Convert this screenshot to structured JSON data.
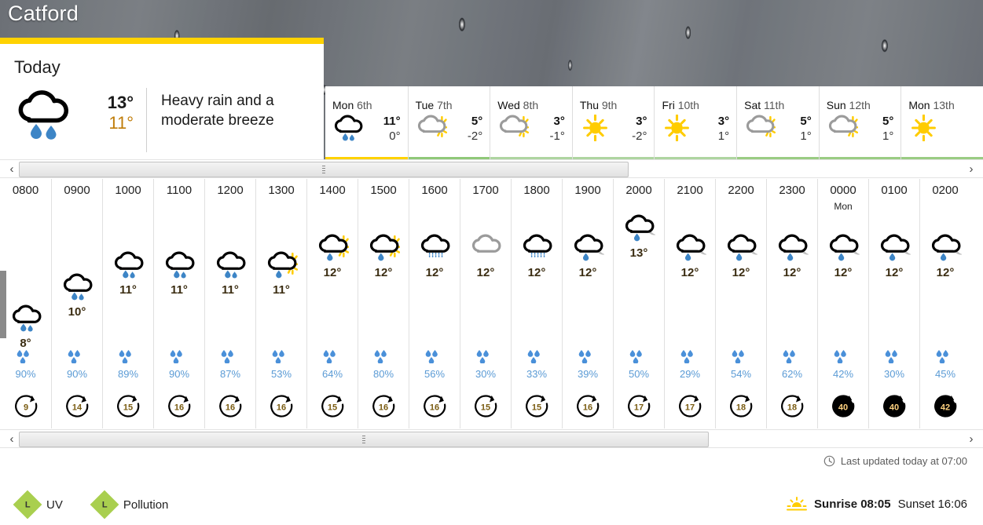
{
  "location": {
    "name": "Catford"
  },
  "today": {
    "label": "Today",
    "icon": "heavy-rain-icon",
    "high": "13°",
    "low": "11°",
    "description": "Heavy rain and a moderate breeze"
  },
  "day_tabs": [
    {
      "day": "Mon",
      "date": "6th",
      "icon": "light-rain-icon",
      "high": "11°",
      "low": "0°",
      "bar_color": "#ffd200",
      "active": true
    },
    {
      "day": "Tue",
      "date": "7th",
      "icon": "sunny-intervals-icon",
      "high": "5°",
      "low": "-2°",
      "bar_color": "#8fc878",
      "active": false
    },
    {
      "day": "Wed",
      "date": "8th",
      "icon": "sunny-intervals-icon",
      "high": "3°",
      "low": "-1°",
      "bar_color": "#aed5a0",
      "active": false
    },
    {
      "day": "Thu",
      "date": "9th",
      "icon": "sunny-icon",
      "high": "3°",
      "low": "-2°",
      "bar_color": "#aed5a0",
      "active": false
    },
    {
      "day": "Fri",
      "date": "10th",
      "icon": "sunny-icon",
      "high": "3°",
      "low": "1°",
      "bar_color": "#aed5a0",
      "active": false
    },
    {
      "day": "Sat",
      "date": "11th",
      "icon": "sunny-intervals-icon",
      "high": "5°",
      "low": "1°",
      "bar_color": "#9acc83",
      "active": false
    },
    {
      "day": "Sun",
      "date": "12th",
      "icon": "sunny-intervals-icon",
      "high": "5°",
      "low": "1°",
      "bar_color": "#9acc83",
      "active": false
    },
    {
      "day": "Mon",
      "date": "13th",
      "icon": "sunny-icon",
      "high": "",
      "low": "",
      "bar_color": "#9acc83",
      "active": false
    }
  ],
  "hourly": [
    {
      "time": "0800",
      "day": "",
      "icon": "light-rain-icon",
      "temp": "8°",
      "precip": "90%",
      "wind": "9",
      "wind_gale": false,
      "wind_dir": 40
    },
    {
      "time": "0900",
      "day": "",
      "icon": "light-rain-icon",
      "temp": "10°",
      "precip": "90%",
      "wind": "14",
      "wind_gale": false,
      "wind_dir": 45
    },
    {
      "time": "1000",
      "day": "",
      "icon": "light-rain-icon",
      "temp": "11°",
      "precip": "89%",
      "wind": "15",
      "wind_gale": false,
      "wind_dir": 40
    },
    {
      "time": "1100",
      "day": "",
      "icon": "light-rain-icon",
      "temp": "11°",
      "precip": "90%",
      "wind": "16",
      "wind_gale": false,
      "wind_dir": 45
    },
    {
      "time": "1200",
      "day": "",
      "icon": "light-rain-icon",
      "temp": "11°",
      "precip": "87%",
      "wind": "16",
      "wind_gale": false,
      "wind_dir": 45
    },
    {
      "time": "1300",
      "day": "",
      "icon": "light-rain-sun-icon",
      "temp": "11°",
      "precip": "53%",
      "wind": "16",
      "wind_gale": false,
      "wind_dir": 45
    },
    {
      "time": "1400",
      "day": "",
      "icon": "light-rain-sun-icon",
      "temp": "12°",
      "precip": "64%",
      "wind": "15",
      "wind_gale": false,
      "wind_dir": 45
    },
    {
      "time": "1500",
      "day": "",
      "icon": "light-rain-sun-icon",
      "temp": "12°",
      "precip": "80%",
      "wind": "16",
      "wind_gale": false,
      "wind_dir": 45
    },
    {
      "time": "1600",
      "day": "",
      "icon": "drizzle-icon",
      "temp": "12°",
      "precip": "56%",
      "wind": "16",
      "wind_gale": false,
      "wind_dir": 45
    },
    {
      "time": "1700",
      "day": "",
      "icon": "cloudy-icon",
      "temp": "12°",
      "precip": "30%",
      "wind": "15",
      "wind_gale": false,
      "wind_dir": 40
    },
    {
      "time": "1800",
      "day": "",
      "icon": "drizzle-icon",
      "temp": "12°",
      "precip": "33%",
      "wind": "15",
      "wind_gale": false,
      "wind_dir": 40
    },
    {
      "time": "1900",
      "day": "",
      "icon": "light-rain-night-icon",
      "temp": "12°",
      "precip": "39%",
      "wind": "16",
      "wind_gale": false,
      "wind_dir": 40
    },
    {
      "time": "2000",
      "day": "",
      "icon": "light-rain-night-icon",
      "temp": "13°",
      "precip": "50%",
      "wind": "17",
      "wind_gale": false,
      "wind_dir": 40
    },
    {
      "time": "2100",
      "day": "",
      "icon": "light-rain-night-icon",
      "temp": "12°",
      "precip": "29%",
      "wind": "17",
      "wind_gale": false,
      "wind_dir": 40
    },
    {
      "time": "2200",
      "day": "",
      "icon": "light-rain-night-icon",
      "temp": "12°",
      "precip": "54%",
      "wind": "18",
      "wind_gale": false,
      "wind_dir": 40
    },
    {
      "time": "2300",
      "day": "",
      "icon": "light-rain-night-icon",
      "temp": "12°",
      "precip": "62%",
      "wind": "18",
      "wind_gale": false,
      "wind_dir": 40
    },
    {
      "time": "0000",
      "day": "Mon",
      "icon": "light-rain-night-icon",
      "temp": "12°",
      "precip": "42%",
      "wind": "40",
      "wind_gale": true,
      "wind_dir": 40
    },
    {
      "time": "0100",
      "day": "",
      "icon": "light-rain-night-icon",
      "temp": "12°",
      "precip": "30%",
      "wind": "40",
      "wind_gale": true,
      "wind_dir": 40
    },
    {
      "time": "0200",
      "day": "",
      "icon": "light-rain-night-icon",
      "temp": "12°",
      "precip": "45%",
      "wind": "42",
      "wind_gale": true,
      "wind_dir": 40
    }
  ],
  "footer": {
    "updated_text": "Last updated today at 07:00",
    "updated_icon": "clock-icon",
    "legend": [
      {
        "code": "L",
        "label": "UV",
        "color": "#a9cf4f"
      },
      {
        "code": "L",
        "label": "Pollution",
        "color": "#a9cf4f"
      }
    ],
    "sun_icon": "sunrise-icon",
    "sunrise_label": "Sunrise 08:05",
    "sunset_label": "Sunset 16:06"
  },
  "scrollbars": {
    "top": {
      "left_arrow": "‹",
      "right_arrow": "›",
      "thumb_width_pct": 64.5,
      "thumb_left_pct": 0
    },
    "bottom": {
      "left_arrow": "‹",
      "right_arrow": "›",
      "thumb_width_pct": 73.0,
      "thumb_left_pct": 0
    }
  }
}
